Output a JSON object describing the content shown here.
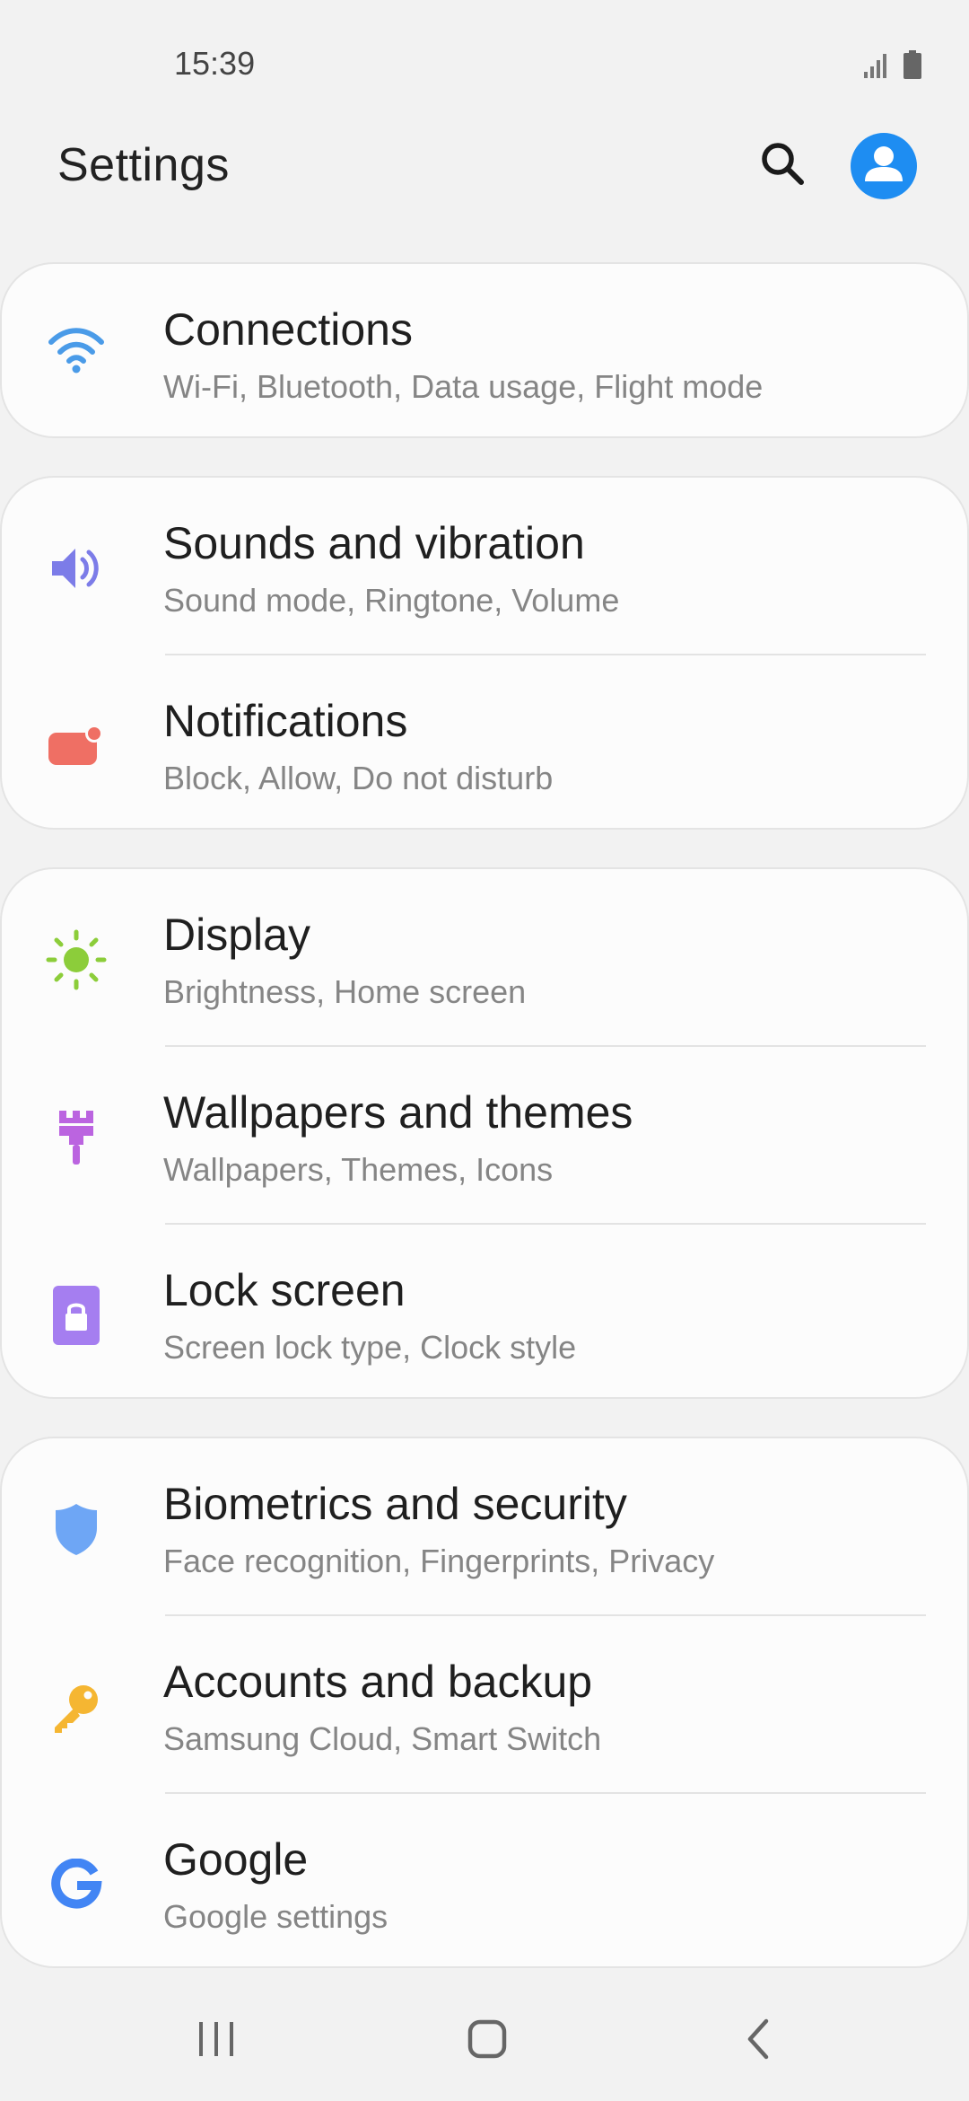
{
  "status_bar": {
    "time": "15:39",
    "signal_icon": "signal-icon",
    "battery_icon": "battery-icon"
  },
  "header": {
    "title": "Settings",
    "search_icon": "search-icon",
    "account_icon": "account-icon"
  },
  "groups": [
    {
      "items": [
        {
          "title": "Connections",
          "subtitle": "Wi-Fi, Bluetooth, Data usage, Flight mode",
          "icon": "wifi-icon",
          "color": "#4a9be8"
        }
      ]
    },
    {
      "items": [
        {
          "title": "Sounds and vibration",
          "subtitle": "Sound mode, Ringtone, Volume",
          "icon": "speaker-icon",
          "color": "#7c7ce8"
        },
        {
          "title": "Notifications",
          "subtitle": "Block, Allow, Do not disturb",
          "icon": "notification-icon",
          "color": "#ef6f64"
        }
      ]
    },
    {
      "items": [
        {
          "title": "Display",
          "subtitle": "Brightness, Home screen",
          "icon": "sun-icon",
          "color": "#8ccd3a"
        },
        {
          "title": "Wallpapers and themes",
          "subtitle": "Wallpapers, Themes, Icons",
          "icon": "paintbrush-icon",
          "color": "#bb64e0"
        },
        {
          "title": "Lock screen",
          "subtitle": "Screen lock type, Clock style",
          "icon": "lock-icon",
          "color": "#a57ef0"
        }
      ]
    },
    {
      "items": [
        {
          "title": "Biometrics and security",
          "subtitle": "Face recognition, Fingerprints, Privacy",
          "icon": "shield-icon",
          "color": "#6ea6f5"
        },
        {
          "title": "Accounts and backup",
          "subtitle": "Samsung Cloud, Smart Switch",
          "icon": "key-icon",
          "color": "#f5b632"
        },
        {
          "title": "Google",
          "subtitle": "Google settings",
          "icon": "google-icon",
          "color": "#4285f4"
        }
      ]
    }
  ],
  "nav": {
    "recents_icon": "recents-icon",
    "home_icon": "home-icon",
    "back_icon": "back-icon"
  }
}
